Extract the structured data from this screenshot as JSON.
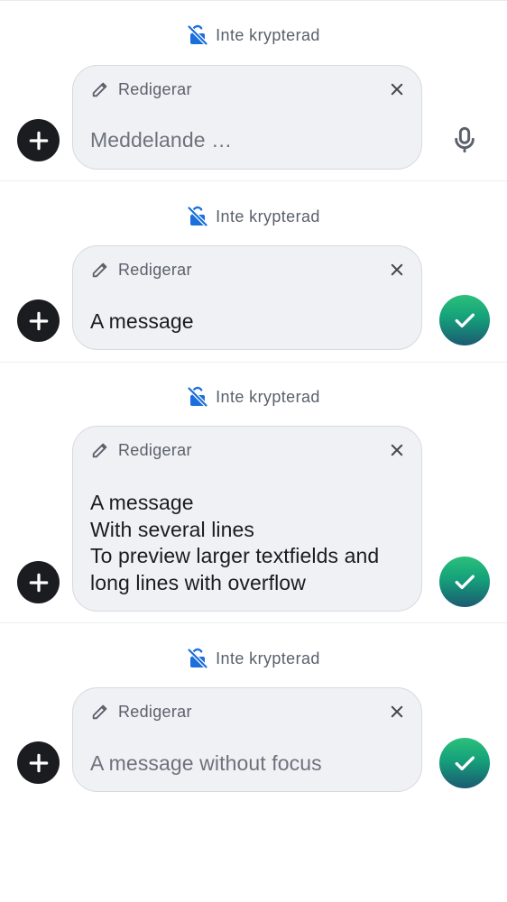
{
  "composers": [
    {
      "encryption_label": "Inte krypterad",
      "edit_label": "Redigerar",
      "message": "Meddelande …",
      "is_placeholder": true,
      "action": "microphone"
    },
    {
      "encryption_label": "Inte krypterad",
      "edit_label": "Redigerar",
      "message": "A message",
      "is_placeholder": false,
      "action": "send"
    },
    {
      "encryption_label": "Inte krypterad",
      "edit_label": "Redigerar",
      "message": "A message\nWith several lines\nTo preview larger textfields and long lines with overflow",
      "is_placeholder": false,
      "action": "send"
    },
    {
      "encryption_label": "Inte krypterad",
      "edit_label": "Redigerar",
      "message": "A message without focus",
      "is_placeholder": false,
      "focused": false,
      "action": "send"
    }
  ],
  "colors": {
    "encryption_icon": "#1a6fdc",
    "add_button": "#1b1c1f",
    "field_background": "#f0f1f4",
    "send_gradient_top": "#2bc07a",
    "send_gradient_bottom": "#1b5a72"
  }
}
